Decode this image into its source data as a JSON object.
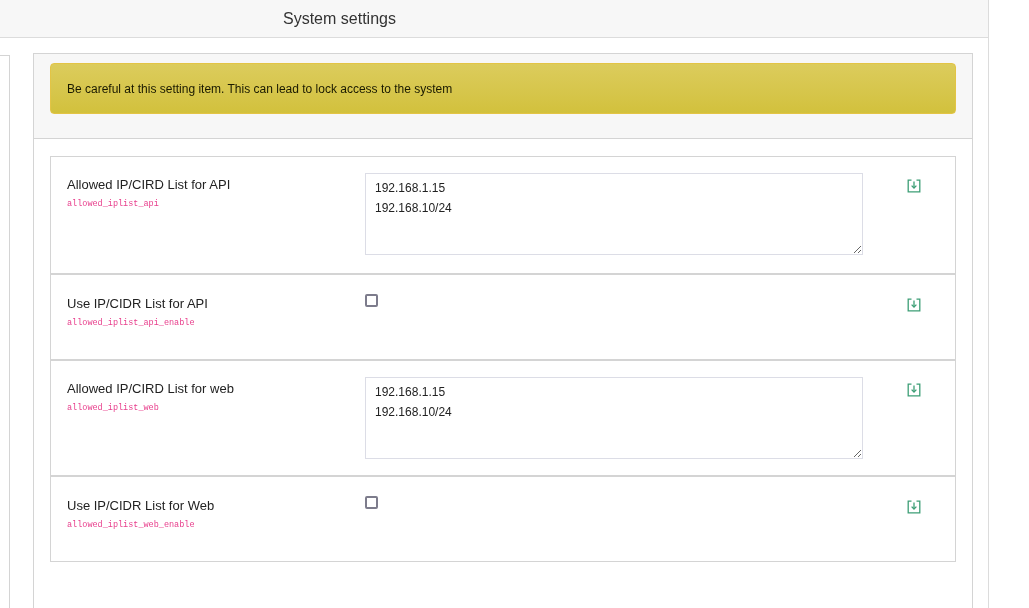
{
  "window": {
    "title": "System settings"
  },
  "warning": "Be careful at this setting item. This can lead to lock access to the system",
  "settings": [
    {
      "kind": "textarea",
      "label": "Allowed IP/CIRD List for API",
      "key": "allowed_iplist_api",
      "value": "192.168.1.15\n192.168.10/24"
    },
    {
      "kind": "checkbox",
      "label": "Use IP/CIDR List for API",
      "key": "allowed_iplist_api_enable",
      "checked": false
    },
    {
      "kind": "textarea",
      "label": "Allowed IP/CIRD List for web",
      "key": "allowed_iplist_web",
      "value": "192.168.1.15\n192.168.10/24"
    },
    {
      "kind": "checkbox",
      "label": "Use IP/CIDR List for Web",
      "key": "allowed_iplist_web_enable",
      "checked": false
    }
  ]
}
